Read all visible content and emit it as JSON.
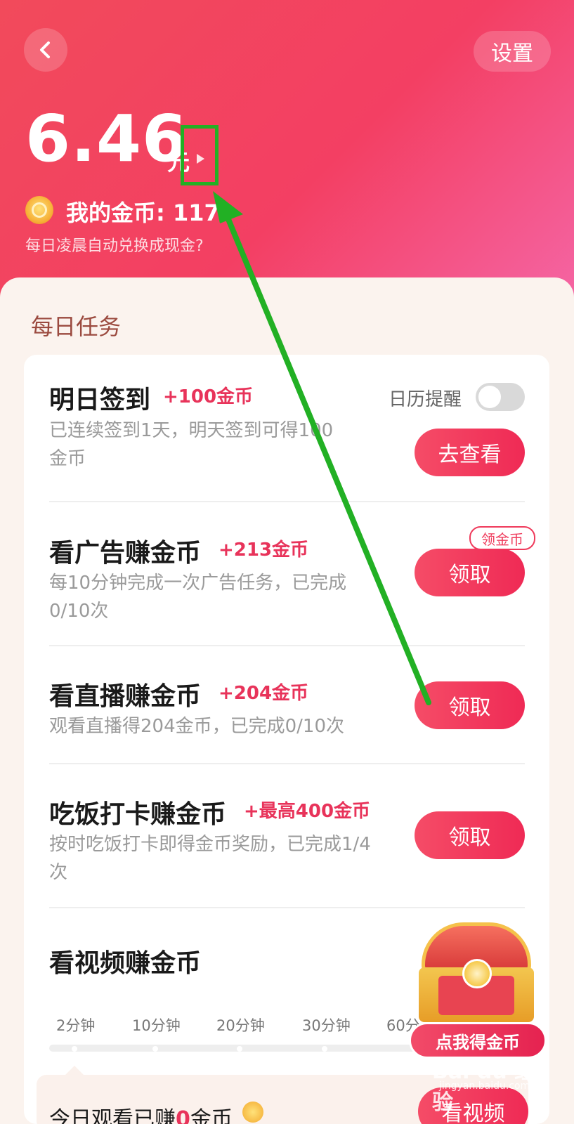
{
  "header": {
    "back_label": "",
    "settings_label": "设置",
    "balance_value": "6.46",
    "balance_unit": "元",
    "coins_label": "我的金币: 117",
    "auto_note": "每日凌晨自动兑换成现金?"
  },
  "section": {
    "title": "每日任务"
  },
  "tasks": [
    {
      "title": "明日签到",
      "reward": "+100金币",
      "desc": "已连续签到1天，明天签到可得100\n金币",
      "button": "去查看",
      "calendar_label": "日历提醒",
      "calendar_enabled": false
    },
    {
      "title": "看广告赚金币",
      "reward": "+213金币",
      "desc": "每10分钟完成一次广告任务，已完成\n0/10次",
      "button": "领取",
      "badge": "领金币"
    },
    {
      "title": "看直播赚金币",
      "reward": "+204金币",
      "desc": "观看直播得204金币，已完成0/10次",
      "button": "领取"
    },
    {
      "title": "吃饭打卡赚金币",
      "reward": "+最高400金币",
      "desc": "按时吃饭打卡即得金币奖励，已完成1/4\n次",
      "button": "领取"
    }
  ],
  "video_task": {
    "title": "看视频赚金币",
    "timeline": [
      "2分钟",
      "10分钟",
      "20分钟",
      "30分钟",
      "60分"
    ],
    "today_prefix": "今日观看已赚",
    "today_count": "0",
    "today_suffix": "金币",
    "button": "看视频"
  },
  "chest": {
    "button": "点我得金币"
  },
  "watermark": {
    "main": "Bai du 经验",
    "sub": "jingyan.baidu.com"
  },
  "colors": {
    "accent": "#ef2a55",
    "header_start": "#f24a5b",
    "header_end": "#f567a7",
    "annotation": "#22b024"
  }
}
